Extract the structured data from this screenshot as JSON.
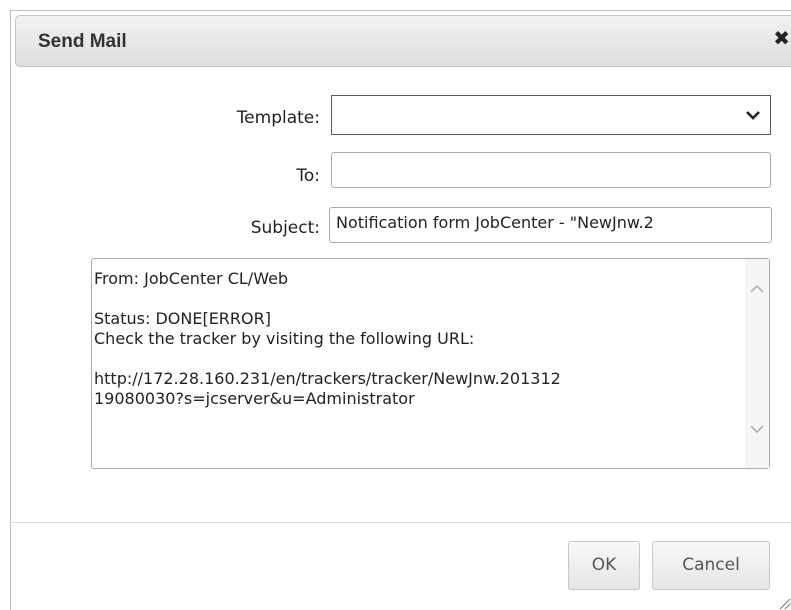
{
  "dialog": {
    "title": "Send Mail",
    "close_icon": "close-icon"
  },
  "form": {
    "template_label": "Template:",
    "template_value": "",
    "to_label": "To:",
    "to_value": "",
    "subject_label": "Subject:",
    "subject_value": "Notification form JobCenter - \"NewJnw.2",
    "body_lines": [
      "From: JobCenter CL/Web",
      "",
      "Status: DONE[ERROR]",
      "Check the tracker by visiting the following URL:",
      "",
      "http://172.28.160.231/en/trackers/tracker/NewJnw.201312",
      "19080030?s=jcserver&u=Administrator"
    ]
  },
  "buttons": {
    "ok_label": "OK",
    "cancel_label": "Cancel"
  },
  "icons": {
    "select": "chevron-down-icon",
    "scroll_up": "chevron-up-icon",
    "scroll_down": "chevron-down-icon",
    "resize": "resize-grip-icon"
  }
}
